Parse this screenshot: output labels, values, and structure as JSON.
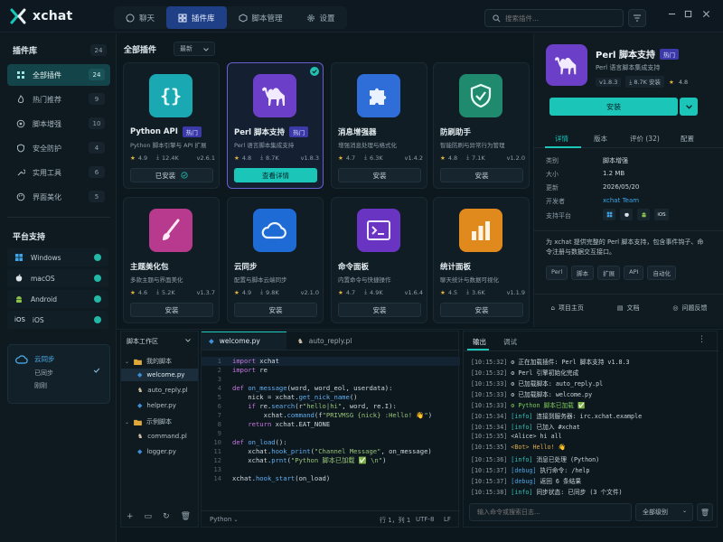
{
  "app": {
    "title": "xchat"
  },
  "nav": {
    "tabs": [
      {
        "label": "聊天",
        "icon": "chat-icon"
      },
      {
        "label": "插件库",
        "icon": "grid-icon"
      },
      {
        "label": "脚本管理",
        "icon": "code-icon"
      },
      {
        "label": "设置",
        "icon": "gear-icon"
      }
    ]
  },
  "search": {
    "placeholder": "搜索插件..."
  },
  "sidebar": {
    "title": "插件库",
    "total": "24",
    "items": [
      {
        "label": "全部插件",
        "count": "24"
      },
      {
        "label": "热门推荐",
        "count": "9"
      },
      {
        "label": "脚本增强",
        "count": "10"
      },
      {
        "label": "安全防护",
        "count": "4"
      },
      {
        "label": "实用工具",
        "count": "6"
      },
      {
        "label": "界面美化",
        "count": "5"
      }
    ],
    "platform_title": "平台支持",
    "platforms": [
      {
        "label": "Windows",
        "icon": "windows-icon"
      },
      {
        "label": "macOS",
        "icon": "apple-icon"
      },
      {
        "label": "Android",
        "icon": "android-icon"
      },
      {
        "label": "iOS",
        "icon": "ios-icon"
      }
    ],
    "sync": {
      "title": "云同步",
      "status": "已同步",
      "time": "刚刚"
    }
  },
  "main": {
    "title": "全部插件",
    "sort": "最新"
  },
  "cards": [
    {
      "name": "Python API",
      "hot": "热门",
      "desc": "Python 脚本引擎与 API 扩展",
      "rating": "4.9",
      "downloads": "12.4K",
      "version": "v2.6.1",
      "button": "已安装",
      "color": "#1aa9b3"
    },
    {
      "name": "Perl 脚本支持",
      "hot": "热门",
      "desc": "Perl 语言脚本集成支持",
      "rating": "4.8",
      "downloads": "8.7K",
      "version": "v1.8.3",
      "button": "查看详情",
      "color": "#6b3fc7"
    },
    {
      "name": "消息增强器",
      "hot": "",
      "desc": "增强消息处理与格式化",
      "rating": "4.7",
      "downloads": "6.3K",
      "version": "v1.4.2",
      "button": "安装",
      "color": "#2f6ed8"
    },
    {
      "name": "防刷助手",
      "hot": "",
      "desc": "智能防刷与异常行为管理",
      "rating": "4.8",
      "downloads": "7.1K",
      "version": "v1.2.0",
      "button": "安装",
      "color": "#1f8a6d"
    },
    {
      "name": "主题美化包",
      "hot": "",
      "desc": "多款主题与界面美化",
      "rating": "4.6",
      "downloads": "5.2K",
      "version": "v1.3.7",
      "button": "安装",
      "color": "#b73a8e"
    },
    {
      "name": "云同步",
      "hot": "",
      "desc": "配置与脚本云端同步",
      "rating": "4.9",
      "downloads": "9.8K",
      "version": "v2.1.0",
      "button": "安装",
      "color": "#1f6bd6"
    },
    {
      "name": "命令面板",
      "hot": "",
      "desc": "内置命令与快捷操作",
      "rating": "4.7",
      "downloads": "4.9K",
      "version": "v1.6.4",
      "button": "安装",
      "color": "#6a34c2"
    },
    {
      "name": "统计面板",
      "hot": "",
      "desc": "聊天统计与数据可视化",
      "rating": "4.5",
      "downloads": "3.6K",
      "version": "v1.1.9",
      "button": "安装",
      "color": "#e08a1e"
    }
  ],
  "detail": {
    "name": "Perl 脚本支持",
    "hot": "热门",
    "desc": "Perl 语言脚本集成支持",
    "version": "v1.8.3",
    "downloads": "8.7K 安装",
    "rating": "4.8",
    "install": "安装",
    "tabs": [
      "详情",
      "版本",
      "评价 (32)",
      "配置"
    ],
    "rows": [
      {
        "k": "类别",
        "v": "脚本增强"
      },
      {
        "k": "大小",
        "v": "1.2 MB"
      },
      {
        "k": "更新",
        "v": "2026/05/20"
      },
      {
        "k": "开发者",
        "v": "xchat Team"
      },
      {
        "k": "支持平台",
        "v": ""
      }
    ],
    "about1": "为 xchat 提供完整的 Perl 脚本支持，包含事件钩子、命",
    "about2": "令注册与数据交互接口。",
    "tags": [
      "Perl",
      "脚本",
      "扩展",
      "API",
      "自动化"
    ],
    "links": [
      "项目主页",
      "文档",
      "问题反馈"
    ]
  },
  "explorer": {
    "title": "脚本工作区",
    "folder1": "我的脚本",
    "files1": [
      "welcome.py",
      "auto_reply.pl",
      "helper.py"
    ],
    "folder2": "示例脚本",
    "files2": [
      "command.pl",
      "logger.py"
    ]
  },
  "editor": {
    "tabs": [
      "welcome.py",
      "auto_reply.pl"
    ],
    "language": "Python",
    "position": "行 1，列 1",
    "encoding": "UTF-8",
    "eol": "LF"
  },
  "console": {
    "tabs": [
      "输出",
      "调试"
    ],
    "input_placeholder": "输入命令或搜索日志...",
    "level": "全部级别"
  }
}
